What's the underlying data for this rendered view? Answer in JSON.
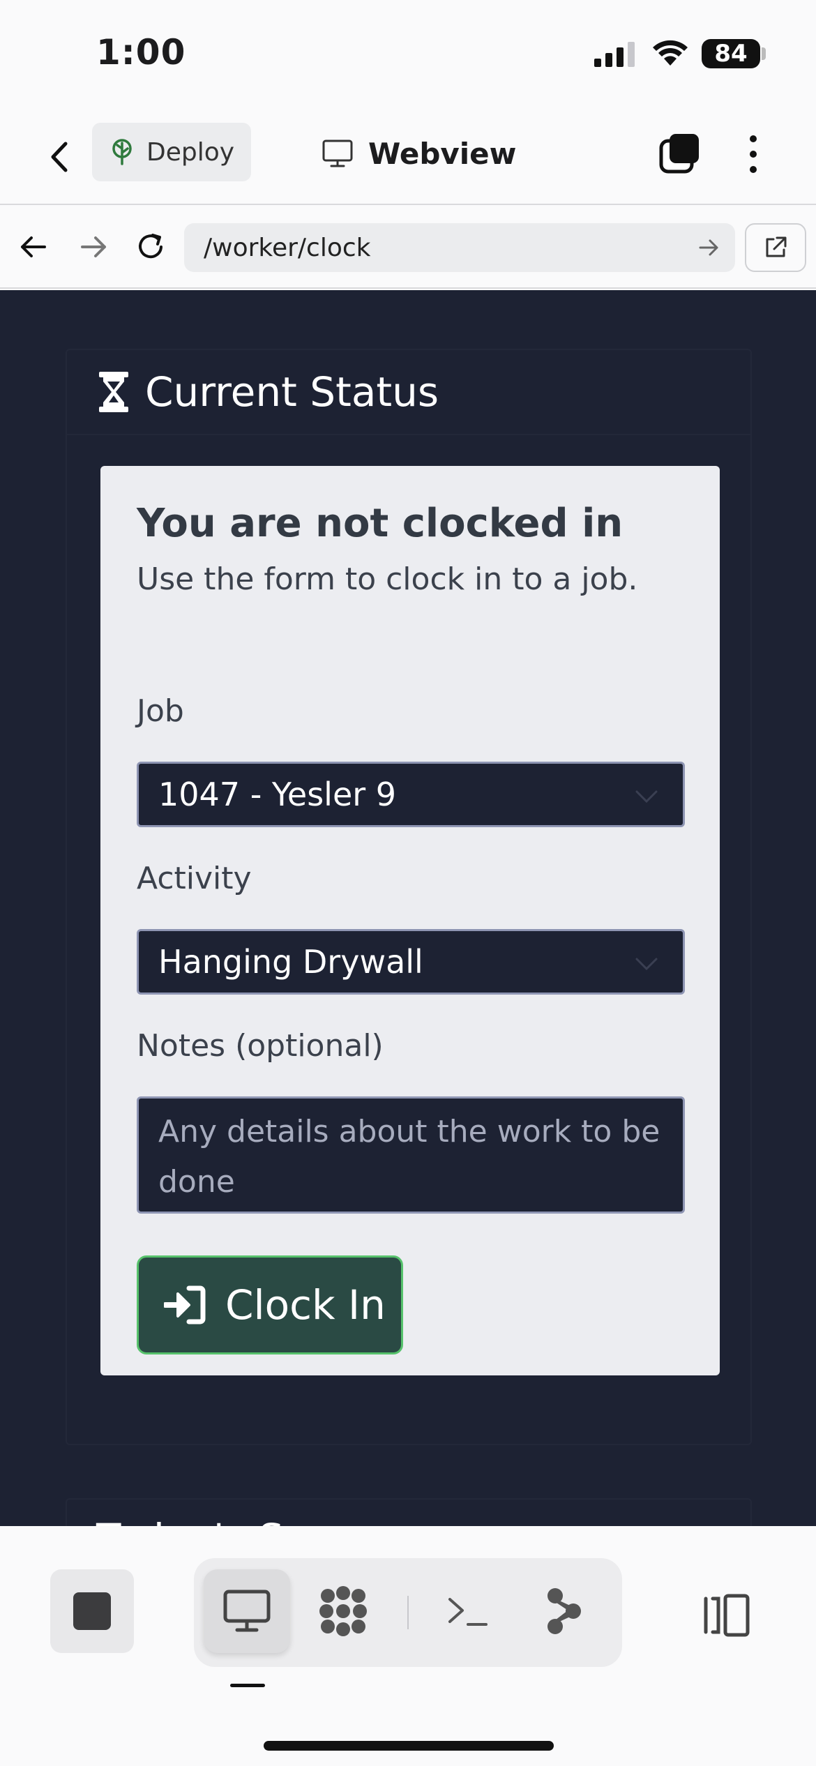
{
  "status_bar": {
    "time": "1:00",
    "battery": "84"
  },
  "header": {
    "deploy_label": "Deploy",
    "title": "Webview"
  },
  "browser": {
    "url": "/worker/clock"
  },
  "panel": {
    "title": "Current Status",
    "card_title": "You are not clocked in",
    "card_subtitle": "Use the form to clock in to a job.",
    "job_label": "Job",
    "job_value": "1047 - Yesler 9",
    "activity_label": "Activity",
    "activity_value": "Hanging Drywall",
    "notes_label": "Notes (optional)",
    "notes_placeholder": "Any details about the work to be done",
    "clock_in_label": "Clock In"
  },
  "next_panel": {
    "title_partial": "Today's S..."
  },
  "colors": {
    "content_bg": "#1d2233",
    "card_bg": "#ecedf1",
    "button_green": "#2a4a44",
    "button_border": "#57c26c"
  }
}
